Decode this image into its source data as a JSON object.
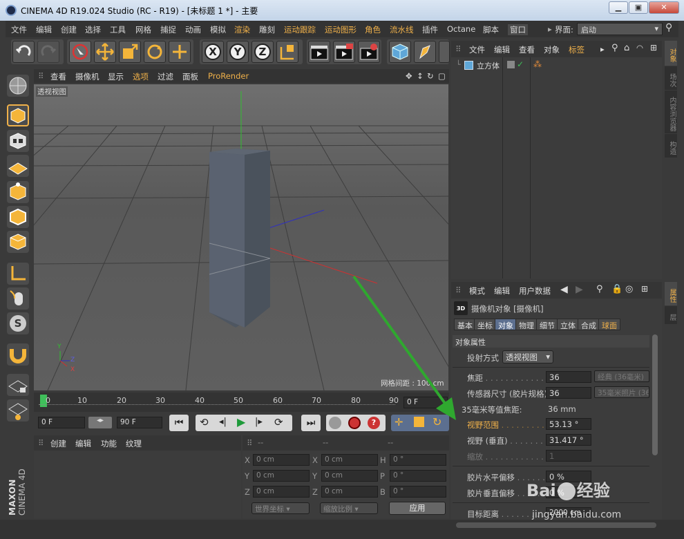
{
  "window": {
    "title": "CINEMA 4D R19.024 Studio (RC - R19) - [未标题 1 *] - 主要",
    "buttons": [
      "▁",
      "▣",
      "✕"
    ]
  },
  "menubar": {
    "items": [
      "文件",
      "编辑",
      "创建",
      "选择",
      "工具",
      "网格",
      "捕捉",
      "动画",
      "模拟",
      "渲染",
      "雕刻",
      "运动跟踪",
      "运动图形",
      "角色",
      "流水线",
      "插件",
      "Octane",
      "脚本",
      "窗口"
    ],
    "layout_label": "界面:",
    "layout_value": "启动"
  },
  "viewport": {
    "menu": [
      "查看",
      "摄像机",
      "显示",
      "选项",
      "过滤",
      "面板",
      "ProRender"
    ],
    "label": "透视视图",
    "grid_spacing": "网格间距 : 100 cm",
    "axis_y": "Y",
    "axis_z": "Z",
    "axis_x": "X"
  },
  "timeline": {
    "ticks": [
      "0",
      "10",
      "20",
      "30",
      "40",
      "50",
      "60",
      "70",
      "80",
      "90"
    ],
    "current_frame": "0 F",
    "start_frame": "0 F",
    "end_frame": "90 F"
  },
  "material": {
    "menu": [
      "创建",
      "编辑",
      "功能",
      "纹理"
    ],
    "brand_top": "MAXON",
    "brand_bottom": "CINEMA 4D"
  },
  "coords": {
    "header": [
      "--",
      "--",
      "--"
    ],
    "rows": [
      {
        "a": "X",
        "av": "0 cm",
        "b": "X",
        "bv": "0 cm",
        "c": "H",
        "cv": "0 °"
      },
      {
        "a": "Y",
        "av": "0 cm",
        "b": "Y",
        "bv": "0 cm",
        "c": "P",
        "cv": "0 °"
      },
      {
        "a": "Z",
        "av": "0 cm",
        "b": "Z",
        "bv": "0 cm",
        "c": "B",
        "cv": "0 °"
      }
    ],
    "mode": "世界坐标",
    "scale": "缩放比例",
    "apply": "应用"
  },
  "objects": {
    "menu": [
      "文件",
      "编辑",
      "查看",
      "对象",
      "标签"
    ],
    "items": [
      {
        "name": "立方体"
      }
    ]
  },
  "right_tabs_top": [
    "对象",
    "场次",
    "内容浏览器",
    "构造"
  ],
  "right_tabs_bottom": [
    "属性",
    "层"
  ],
  "attributes": {
    "menu": [
      "模式",
      "编辑",
      "用户数据"
    ],
    "object_title": "摄像机对象 [摄像机]",
    "tabs": [
      "基本",
      "坐标",
      "对象",
      "物理",
      "细节",
      "立体",
      "合成",
      "球面"
    ],
    "active_tab": "对象",
    "section": "对象属性",
    "projection_label": "投射方式",
    "projection_value": "透视视图",
    "rows": [
      {
        "label": "焦距",
        "value": "36",
        "extra": "经典 (36毫米)"
      },
      {
        "label": "传感器尺寸 (胶片规格)",
        "value": "36",
        "extra": "35毫米照片 (36"
      },
      {
        "label": "35毫米等值焦距:",
        "value": "36 mm",
        "extra": ""
      },
      {
        "label": "视野范围",
        "value": "53.13 °",
        "extra": "",
        "highlight": true
      },
      {
        "label": "视野 (垂直)",
        "value": "31.417 °",
        "extra": ""
      },
      {
        "label": "缩放",
        "value": "1",
        "extra": ""
      },
      {
        "label": "胶片水平偏移",
        "value": "0 %",
        "extra": ""
      },
      {
        "label": "胶片垂直偏移",
        "value": "0 %",
        "extra": ""
      },
      {
        "label": "目标距离",
        "value": "2000 cm",
        "extra": ""
      }
    ]
  },
  "watermark": {
    "site": "jingyan.baidu.com",
    "brand": "Bai",
    "brand2": "经验"
  },
  "colors": {
    "accent": "#f0b14a",
    "annotation_arrow": "#2fa82f",
    "axis_x": "#d03030",
    "axis_y": "#30c030",
    "axis_z": "#3030c0"
  }
}
